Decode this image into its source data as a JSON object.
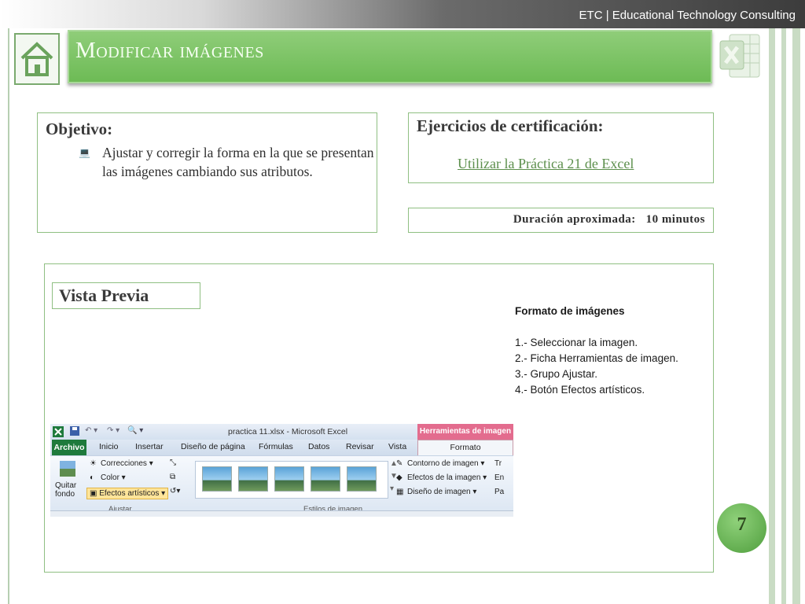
{
  "header": {
    "brand": "ETC | Educational Technology Consulting"
  },
  "slide": {
    "title": "Modificar imágenes",
    "page_number": "7"
  },
  "objective": {
    "heading": "Objetivo:",
    "bullet_icon": "computer-bullet-icon",
    "text": "Ajustar y corregir la forma en la que se presentan las imágenes cambiando sus atributos."
  },
  "exercises": {
    "heading": "Ejercicios de  certificación:",
    "link": "Utilizar la Práctica 21 de Excel"
  },
  "duration": {
    "label": "Duración aproximada:",
    "value": "10 minutos"
  },
  "preview": {
    "title": "Vista Previa",
    "steps_heading": "Formato de imágenes",
    "steps": [
      "1.- Seleccionar la imagen.",
      "2.- Ficha Herramientas de imagen.",
      "3.- Grupo Ajustar.",
      "4.- Botón Efectos artísticos."
    ]
  },
  "ribbon": {
    "file_title": "practica 11.xlsx  -  Microsoft Excel",
    "tools_label": "Herramientas de imagen",
    "tabs": [
      "Archivo",
      "Inicio",
      "Insertar",
      "Diseño de página",
      "Fórmulas",
      "Datos",
      "Revisar",
      "Vista",
      "Formato"
    ],
    "quitar_fondo": "Quitar fondo",
    "correcciones": "Correcciones ▾",
    "color": "Color ▾",
    "efectos": "Efectos artísticos ▾",
    "group_ajustar": "Ajustar",
    "group_estilos": "Estilos de imagen",
    "contorno": "Contorno de imagen ▾",
    "efectos_imagen": "Efectos de la imagen ▾",
    "diseno_imagen": "Diseño de imagen ▾",
    "right_letters": [
      "Tr",
      "En",
      "Pa"
    ]
  },
  "colors": {
    "accent_green": "#6dbb55",
    "tools_pink": "#e36c8e",
    "archivo_green": "#1e7a3c"
  }
}
